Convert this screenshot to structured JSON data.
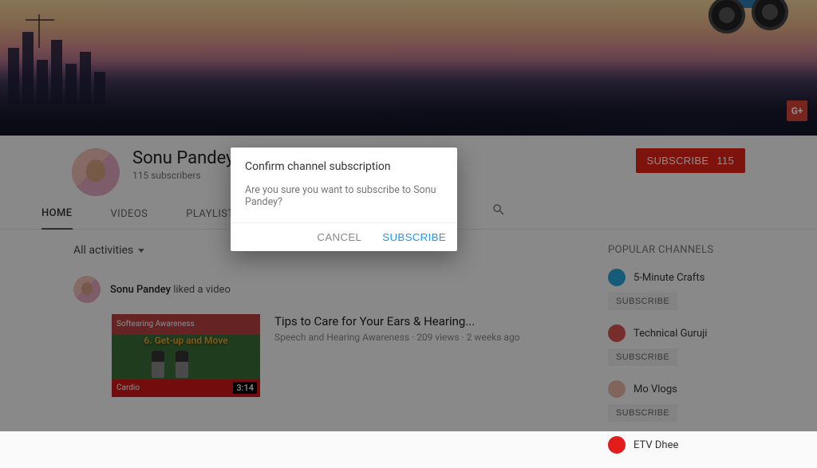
{
  "channel": {
    "name": "Sonu Pandey",
    "subscribers_text": "115 subscribers"
  },
  "subscribe_button": {
    "label": "SUBSCRIBE",
    "count": "115"
  },
  "tabs": {
    "home": "HOME",
    "videos": "VIDEOS",
    "playlists": "PLAYLISTS"
  },
  "filter": {
    "label": "All activities"
  },
  "activity": {
    "actor": "Sonu Pandey",
    "action_text": "liked a video"
  },
  "video": {
    "title": "Tips to Care for Your Ears & Hearing...",
    "byline": "Speech and Hearing Awareness · 209 views · 2 weeks ago",
    "overlay_top": "Softearing Awareness",
    "overlay_title": "6. Get-up and Move",
    "overlay_bottom": "Cardio",
    "duration": "3:14"
  },
  "right": {
    "heading": "POPULAR CHANNELS",
    "items": [
      {
        "name": "5-Minute Crafts",
        "color": "#2aa7df",
        "sub_label": "SUBSCRIBE"
      },
      {
        "name": "Technical Guruji",
        "color": "#d9534f",
        "sub_label": "SUBSCRIBE"
      },
      {
        "name": "Mo Vlogs",
        "color": "#e7b8a7",
        "sub_label": "SUBSCRIBE"
      },
      {
        "name": "ETV Dhee",
        "color": "#e21b1b",
        "sub_label": ""
      }
    ]
  },
  "modal": {
    "title": "Confirm channel subscription",
    "text": "Are you sure you want to subscribe to Sonu Pandey?",
    "cancel": "CANCEL",
    "confirm": "SUBSCRIBE"
  },
  "icons": {
    "gplus": "G+"
  }
}
